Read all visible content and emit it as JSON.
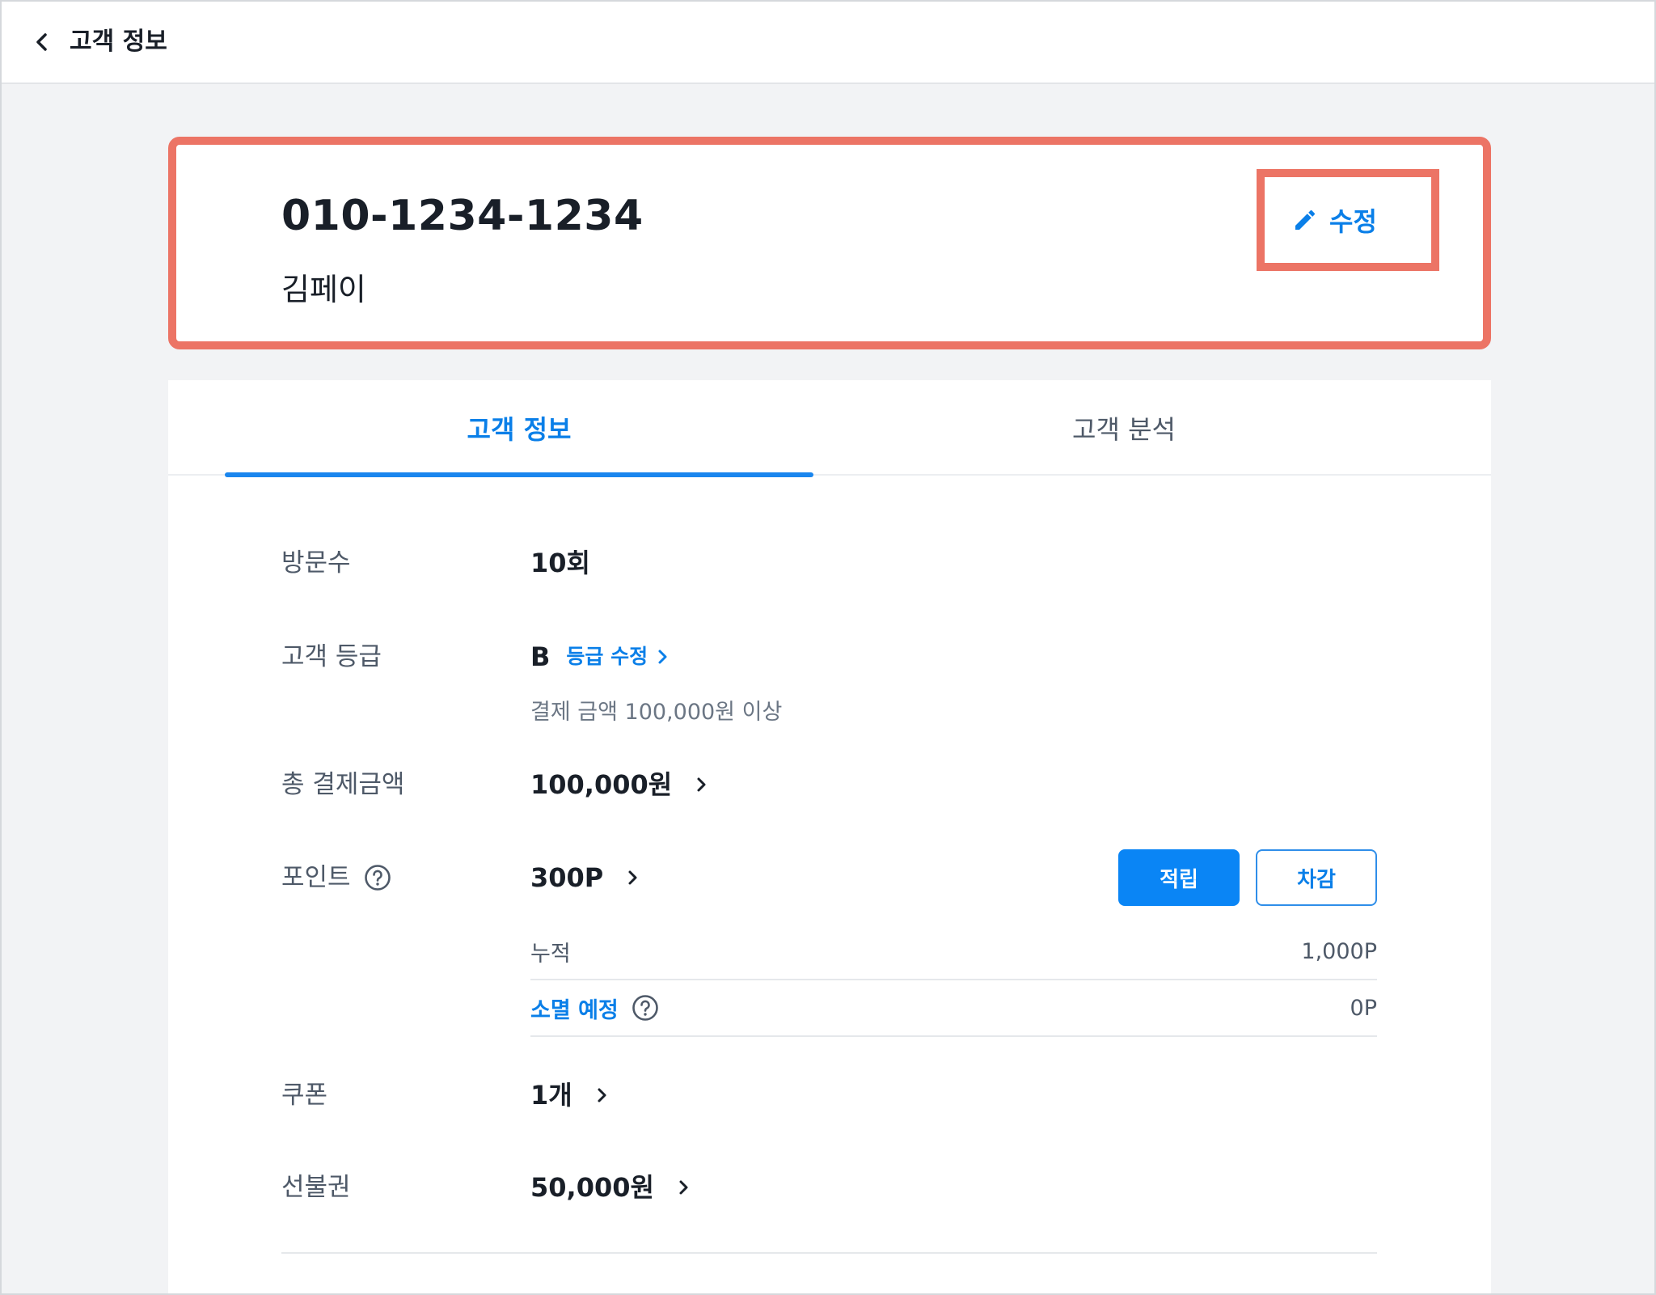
{
  "header": {
    "title": "고객 정보",
    "back_icon": "chevron-left-icon"
  },
  "customer": {
    "phone": "010-1234-1234",
    "name": "김페이",
    "edit_label": "수정",
    "edit_icon": "pencil-icon"
  },
  "tabs": [
    {
      "label": "고객 정보",
      "active": true
    },
    {
      "label": "고객 분석",
      "active": false
    }
  ],
  "info": {
    "visits": {
      "label": "방문수",
      "value": "10회"
    },
    "grade": {
      "label": "고객 등급",
      "value": "B",
      "edit_label": "등급 수정",
      "description": "결제 금액 100,000원 이상"
    },
    "total_payment": {
      "label": "총 결제금액",
      "value": "100,000원"
    },
    "points": {
      "label": "포인트",
      "value": "300P",
      "earn_label": "적립",
      "deduct_label": "차감",
      "accumulated_label": "누적",
      "accumulated_value": "1,000P",
      "expiring_label": "소멸 예정",
      "expiring_value": "0P"
    },
    "coupons": {
      "label": "쿠폰",
      "value": "1개"
    },
    "prepaid": {
      "label": "선불권",
      "value": "50,000원"
    }
  },
  "colors": {
    "accent": "#0a85f5",
    "highlight": "#ec7465",
    "text": "#191f28",
    "muted": "#4e5968"
  }
}
